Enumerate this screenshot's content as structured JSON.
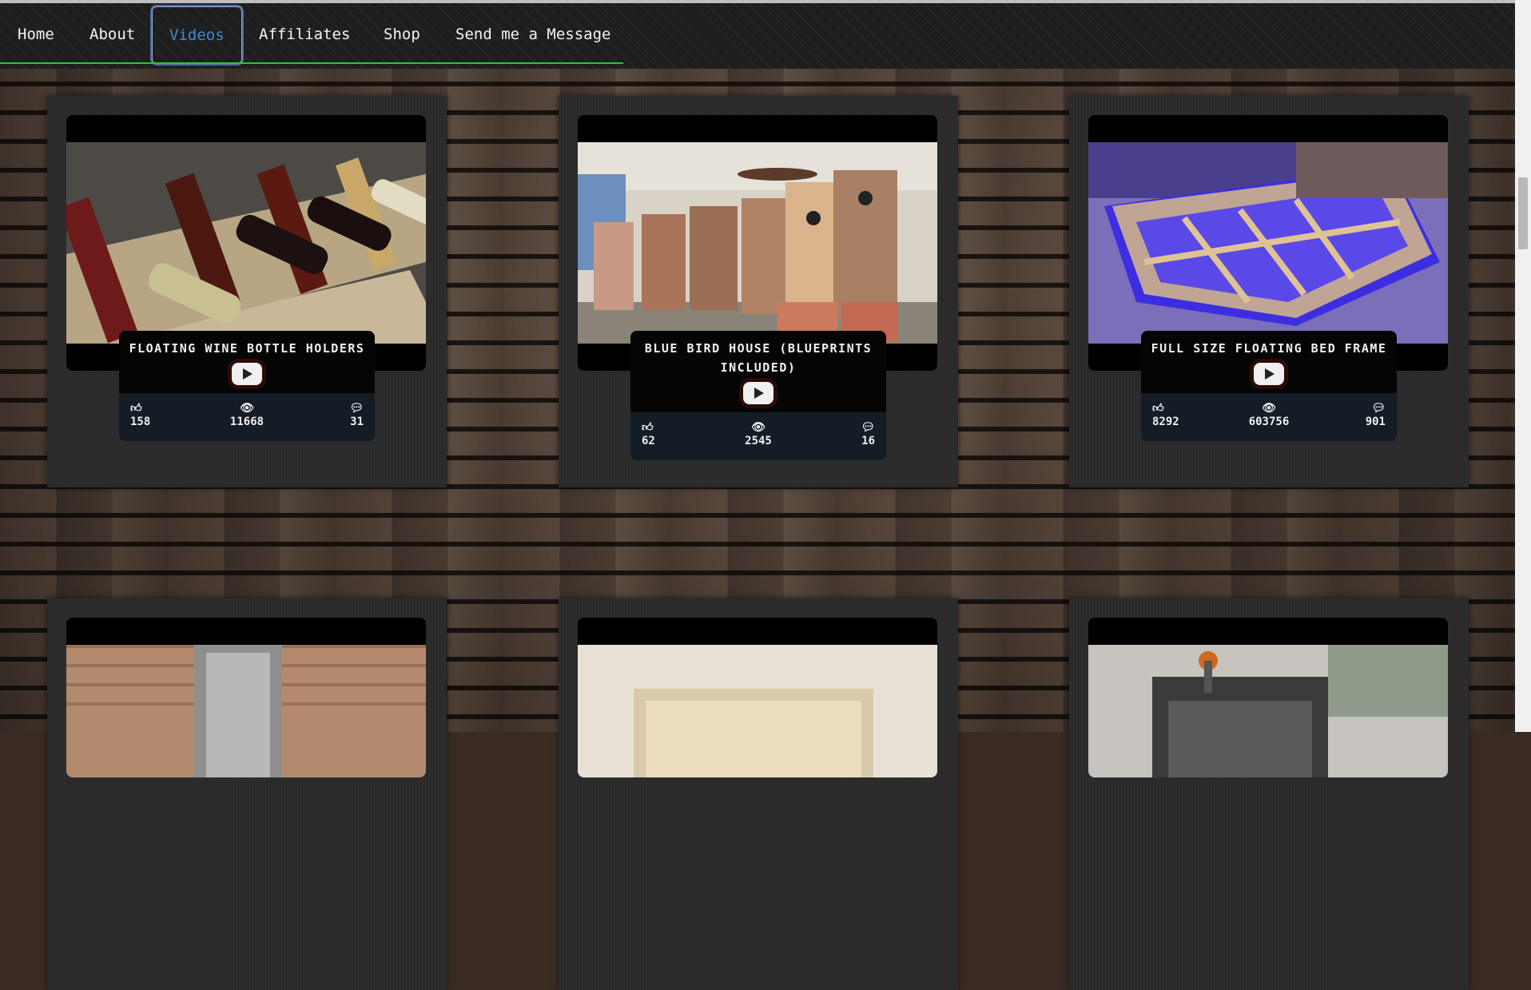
{
  "nav": {
    "items": [
      {
        "label": "Home"
      },
      {
        "label": "About"
      },
      {
        "label": "Videos",
        "active": true
      },
      {
        "label": "Affiliates"
      },
      {
        "label": "Shop"
      },
      {
        "label": "Send me a Message"
      }
    ]
  },
  "colors": {
    "active_nav": "#3d8bd6",
    "nav_underline": "#2ec52e"
  },
  "videos": [
    {
      "title": "FLOATING WINE BOTTLE HOLDERS",
      "likes": "158",
      "views": "11668",
      "comments": "31"
    },
    {
      "title": "BLUE BIRD HOUSE (BLUEPRINTS INCLUDED)",
      "likes": "62",
      "views": "2545",
      "comments": "16"
    },
    {
      "title": "FULL SIZE FLOATING BED FRAME",
      "likes": "8292",
      "views": "603756",
      "comments": "901"
    }
  ],
  "icons": {
    "like": "thumbs-up-icon",
    "views": "eye-icon",
    "comments": "comment-icon",
    "play": "youtube-play-icon"
  }
}
